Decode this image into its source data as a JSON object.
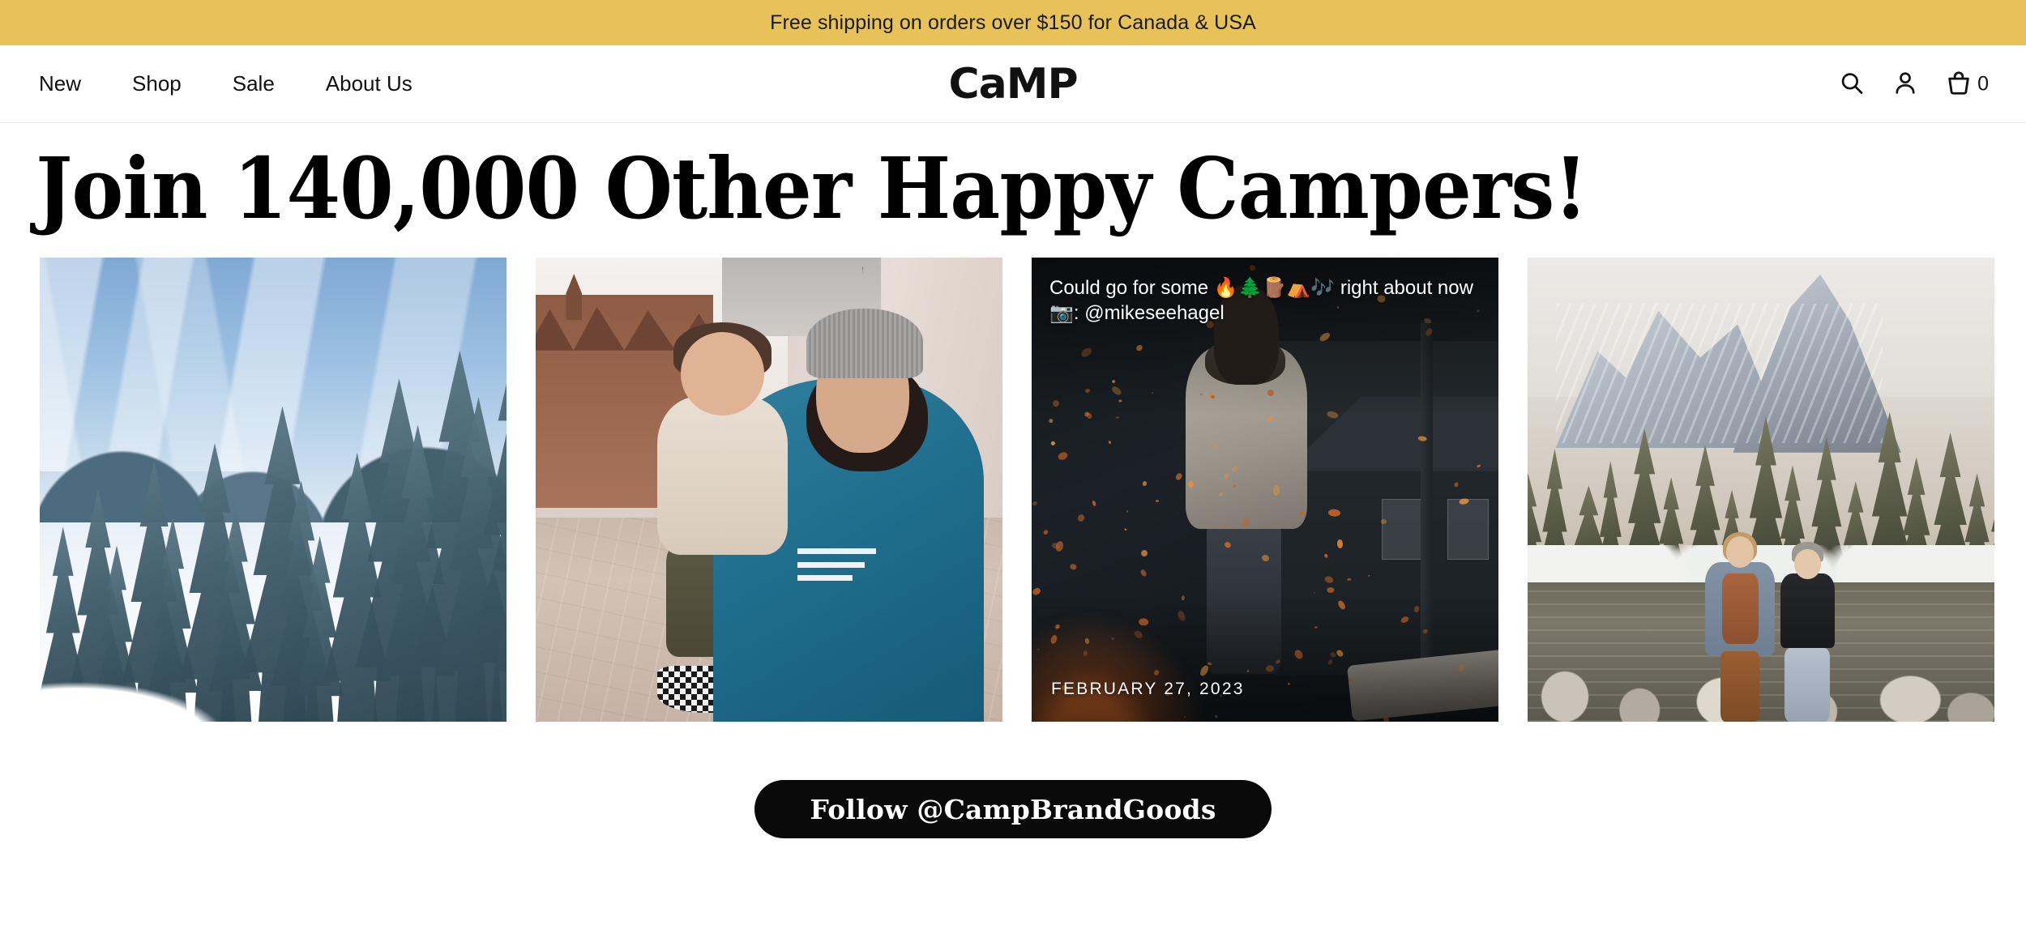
{
  "announcement": {
    "text": "Free shipping on orders over $150 for Canada & USA",
    "background_color": "#e6c259"
  },
  "header": {
    "logo": "CaMP",
    "nav": [
      {
        "label": "New"
      },
      {
        "label": "Shop"
      },
      {
        "label": "Sale"
      },
      {
        "label": "About Us"
      }
    ],
    "actions": {
      "search_icon": "search-icon",
      "account_icon": "account-icon",
      "cart_icon": "cart-icon",
      "cart_count": "0"
    }
  },
  "main": {
    "heading": "Join 140,000 Other Happy Campers!",
    "gallery": [
      {
        "name": "winter-lake",
        "alt": "Snow covered evergreen trees around a frozen lake with rolling hills",
        "caption": "",
        "date": ""
      },
      {
        "name": "dad-and-child",
        "alt": "Man in grey beanie and blue Camp Brand Goods crewneck holding a toddler outdoors",
        "caption": "",
        "date": ""
      },
      {
        "name": "campfire-sparks",
        "alt": "Person in cream hoodie standing beside a campfire throwing orange sparks at dusk",
        "caption": "Could go for some 🔥🌲🪵⛺🎶 right about now 📷: @mikeseehagel",
        "date": "FEBRUARY 27, 2023"
      },
      {
        "name": "mountain-river",
        "alt": "Two women laughing beside a river with snowy mountains and pine forest behind",
        "caption": "",
        "date": ""
      }
    ],
    "follow_button": "Follow @CampBrandGoods"
  },
  "colors": {
    "accent_yellow": "#e6c259",
    "text_dark": "#111111",
    "button_black": "#0a0a0a",
    "page_background": "#ffffff"
  }
}
